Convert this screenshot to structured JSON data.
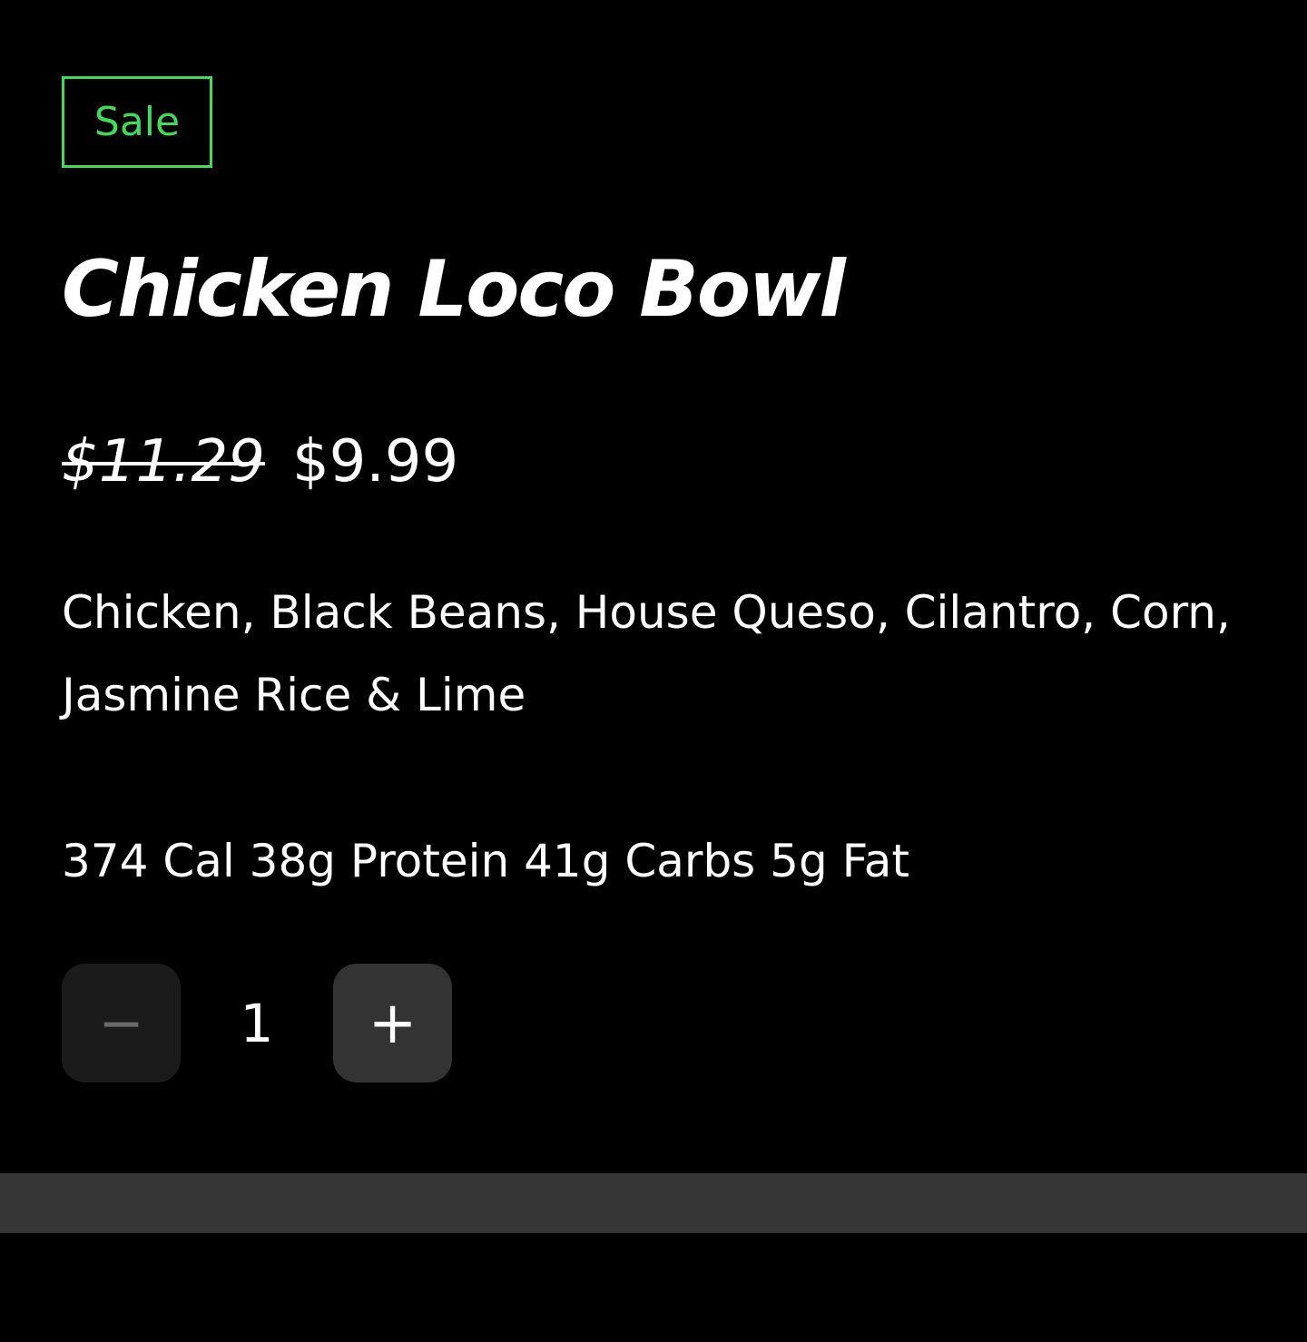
{
  "product": {
    "badge": "Sale",
    "title": "Chicken Loco Bowl",
    "price_original": "$11.29",
    "price_sale": "$9.99",
    "description": "Chicken, Black Beans, House Queso, Cilantro, Corn, Jasmine Rice & Lime",
    "nutrition": "374 Cal 38g Protein 41g Carbs 5g Fat"
  },
  "quantity": {
    "value": "1",
    "decrement_icon": "minus-icon",
    "increment_icon": "plus-icon",
    "decrement_symbol": "−",
    "increment_symbol": "+"
  },
  "colors": {
    "background": "#000000",
    "accent": "#3ddc5a",
    "text": "#ffffff",
    "button_disabled": "#1b1b1b",
    "button_active": "#333333",
    "bar": "#363636"
  }
}
